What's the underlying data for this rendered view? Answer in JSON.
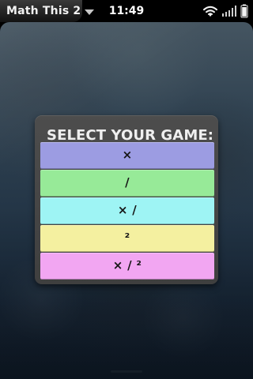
{
  "status_bar": {
    "app_title": "Math This 2",
    "time": "11:49",
    "icons": {
      "menu": "chevron-down-icon",
      "wifi": "wifi-icon",
      "signal": "signal-icon",
      "battery": "battery-icon"
    }
  },
  "dialog": {
    "title": "SELECT YOUR GAME:",
    "options": [
      {
        "label": "×",
        "color": "#9c9ce2"
      },
      {
        "label": "/",
        "color": "#97ea98"
      },
      {
        "label": "× /",
        "color": "#9ef4f4"
      },
      {
        "label": "²",
        "color": "#f4f0a0"
      },
      {
        "label": "× / ²",
        "color": "#f2a6f2"
      }
    ]
  }
}
